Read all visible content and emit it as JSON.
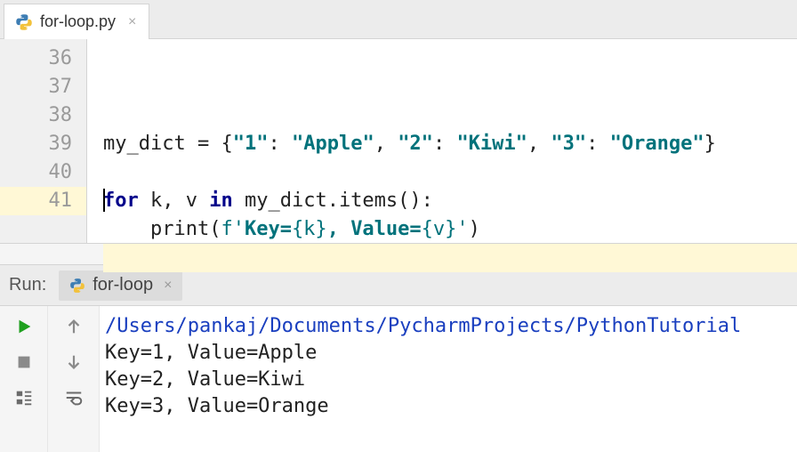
{
  "tab": {
    "filename": "for-loop.py"
  },
  "gutter": {
    "start": 36,
    "end": 41,
    "highlight": 41
  },
  "code": {
    "lines": [
      {
        "n": 36,
        "raw": "",
        "tokens": []
      },
      {
        "n": 37,
        "raw": "my_dict = {\"1\": \"Apple\", \"2\": \"Kiwi\", \"3\": \"Orange\"}",
        "tokens": [
          {
            "t": "my_dict ",
            "c": "pun"
          },
          {
            "t": "=",
            "c": "pun"
          },
          {
            "t": " {",
            "c": "pun"
          },
          {
            "t": "\"1\"",
            "c": "str"
          },
          {
            "t": ": ",
            "c": "pun"
          },
          {
            "t": "\"Apple\"",
            "c": "str"
          },
          {
            "t": ", ",
            "c": "pun"
          },
          {
            "t": "\"2\"",
            "c": "str"
          },
          {
            "t": ": ",
            "c": "pun"
          },
          {
            "t": "\"Kiwi\"",
            "c": "str"
          },
          {
            "t": ", ",
            "c": "pun"
          },
          {
            "t": "\"3\"",
            "c": "str"
          },
          {
            "t": ": ",
            "c": "pun"
          },
          {
            "t": "\"Orange\"",
            "c": "str"
          },
          {
            "t": "}",
            "c": "pun"
          }
        ]
      },
      {
        "n": 38,
        "raw": "",
        "tokens": []
      },
      {
        "n": 39,
        "raw": "for k, v in my_dict.items():",
        "tokens": [
          {
            "t": "for",
            "c": "kw"
          },
          {
            "t": " k, v ",
            "c": "pun"
          },
          {
            "t": "in",
            "c": "kw"
          },
          {
            "t": " my_dict.items():",
            "c": "pun"
          }
        ]
      },
      {
        "n": 40,
        "raw": "    print(f'Key={k}, Value={v}')",
        "tokens": [
          {
            "t": "    print(",
            "c": "fn"
          },
          {
            "t": "f'",
            "c": "strw"
          },
          {
            "t": "Key=",
            "c": "str"
          },
          {
            "t": "{k}",
            "c": "strw"
          },
          {
            "t": ", ",
            "c": "str"
          },
          {
            "t": "Value=",
            "c": "str"
          },
          {
            "t": "{v}",
            "c": "strw"
          },
          {
            "t": "'",
            "c": "strw"
          },
          {
            "t": ")",
            "c": "fn"
          }
        ]
      },
      {
        "n": 41,
        "raw": "",
        "tokens": [],
        "highlight": true
      }
    ]
  },
  "run": {
    "label": "Run:",
    "configName": "for-loop",
    "output": {
      "path": "/Users/pankaj/Documents/PycharmProjects/PythonTutorial",
      "lines": [
        "Key=1, Value=Apple",
        "Key=2, Value=Kiwi",
        "Key=3, Value=Orange"
      ]
    }
  },
  "icons": {
    "tabClose": "×",
    "runTabClose": "×"
  }
}
